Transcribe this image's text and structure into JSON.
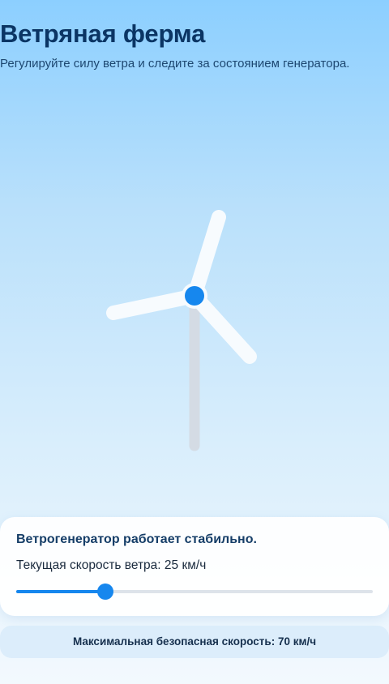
{
  "header": {
    "title": "Ветряная ферма",
    "subtitle": "Регулируйте силу ветра и следите за состоянием генератора."
  },
  "turbine": {
    "blade_color": "#f7fbfe",
    "tower_color": "#d4dbe4",
    "hub_color": "#1687ee"
  },
  "status": {
    "message": "Ветрогенератор работает стабильно.",
    "speed_label": "Текущая скорость ветра: 25 км/ч"
  },
  "wind_slider": {
    "value": 25,
    "max": 100,
    "fill_color": "#1687ee",
    "track_color": "#dde3ea"
  },
  "footer": {
    "max_safe_speed": "Максимальная безопасная скорость: 70 км/ч"
  }
}
